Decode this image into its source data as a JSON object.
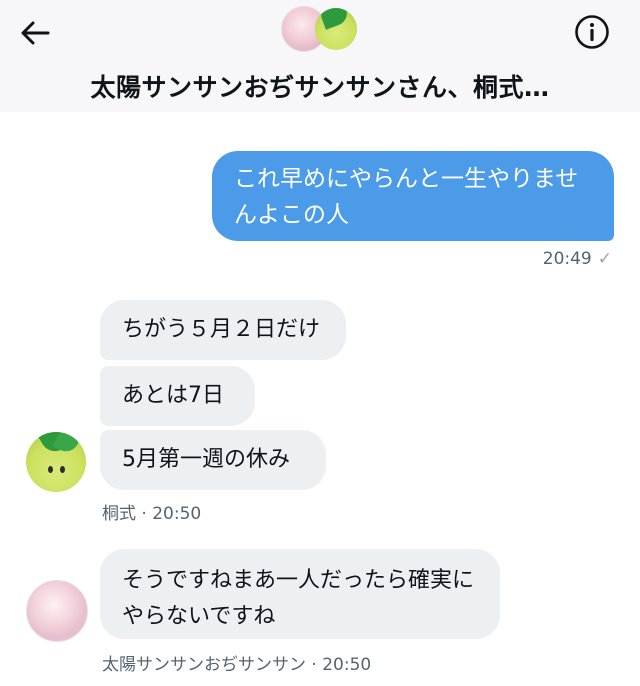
{
  "header": {
    "title": "太陽サンサンおぢサンサンさん、桐式…",
    "back_icon": "arrow-left-icon",
    "info_icon": "info-circle-icon"
  },
  "messages": [
    {
      "direction": "outgoing",
      "text": "これ早めにやらんと一生やりませんよこの人",
      "time": "20:49",
      "status_icon": "check-icon"
    },
    {
      "direction": "incoming",
      "group": [
        {
          "text": "ちがう５月２日だけ"
        },
        {
          "text": "あとは7日"
        },
        {
          "text": "5月第一週の休み"
        }
      ],
      "meta": "桐式 · 20:50"
    },
    {
      "direction": "incoming",
      "group": [
        {
          "text": "そうですねまあ一人だったら確実にやらないですね"
        }
      ],
      "meta": "太陽サンサンおぢサンサン · 20:50"
    }
  ],
  "colors": {
    "outgoing_bubble": "#4c9be8",
    "incoming_bubble": "#edf0f3",
    "meta_text": "#536471"
  }
}
